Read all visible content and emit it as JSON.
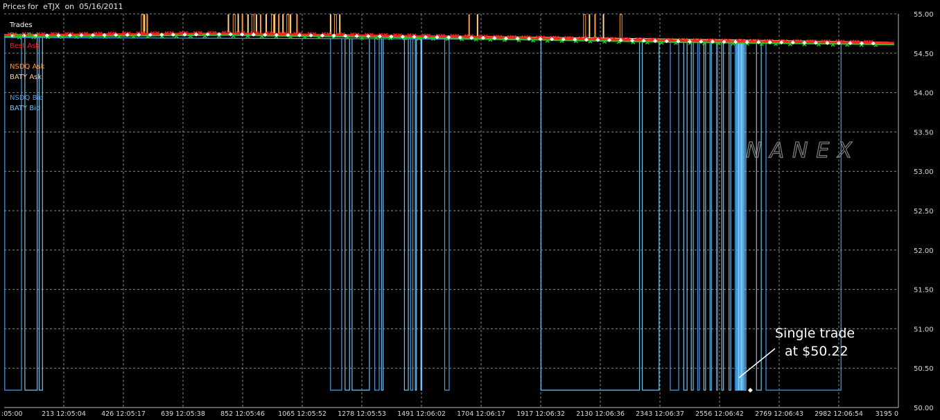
{
  "header": {
    "title": "Prices for  eTJX  on  05/16/2011"
  },
  "watermark": "NANEX",
  "colors": {
    "background": "#000000",
    "grid": "#8a8a8a",
    "trades": "#ffffff",
    "best_bid": "#22cc22",
    "best_ask": "#ff2020",
    "nsdq_ask": "#ff9a3c",
    "baty_ask": "#ffd28a",
    "nsdq_bid": "#4a9ee8",
    "baty_bid": "#6fc4f2"
  },
  "chart_data": {
    "type": "line",
    "title": "Prices for  eTJX  on  05/16/2011",
    "xlabel": "",
    "ylabel": "",
    "xlim": [
      0,
      3195
    ],
    "ylim": [
      50.0,
      55.0
    ],
    "grid": true,
    "legend_placement": "top-left",
    "y_ticks": [
      "50.00",
      "50.50",
      "51.00",
      "51.50",
      "52.00",
      "52.50",
      "53.00",
      "53.50",
      "54.00",
      "54.50",
      "55.00"
    ],
    "x_ticks": [
      {
        "x": 0,
        "label": ":05:00"
      },
      {
        "x": 213,
        "label": "213 12:05:04"
      },
      {
        "x": 426,
        "label": "426 12:05:17"
      },
      {
        "x": 639,
        "label": "639 12:05:38"
      },
      {
        "x": 852,
        "label": "852 12:05:46"
      },
      {
        "x": 1065,
        "label": "1065 12:05:52"
      },
      {
        "x": 1278,
        "label": "1278 12:05:53"
      },
      {
        "x": 1491,
        "label": "1491 12:06:02"
      },
      {
        "x": 1704,
        "label": "1704 12:06:17"
      },
      {
        "x": 1917,
        "label": "1917 12:06:32"
      },
      {
        "x": 2130,
        "label": "2130 12:06:36"
      },
      {
        "x": 2343,
        "label": "2343 12:06:37"
      },
      {
        "x": 2556,
        "label": "2556 12:06:42"
      },
      {
        "x": 2769,
        "label": "2769 12:06:43"
      },
      {
        "x": 2982,
        "label": "2982 12:06:54"
      },
      {
        "x": 3195,
        "label": "3195 0"
      }
    ],
    "legend": [
      {
        "key": "trades",
        "label": "Trades"
      },
      {
        "key": "best_bid",
        "label": "Best Bid"
      },
      {
        "key": "best_ask",
        "label": "Best Ask"
      },
      {
        "key": "nsdq_ask",
        "label": "NSDQ Ask"
      },
      {
        "key": "baty_ask",
        "label": "BATY Ask"
      },
      {
        "key": "nsdq_bid",
        "label": "NSDQ Bid"
      },
      {
        "key": "baty_bid",
        "label": "BATY Bid"
      }
    ],
    "series": [
      {
        "name": "Best Ask",
        "x": [
          0,
          800,
          1600,
          2400,
          3195
        ],
        "values": [
          54.73,
          54.75,
          54.71,
          54.66,
          54.63
        ]
      },
      {
        "name": "Best Bid",
        "x": [
          0,
          800,
          1600,
          2400,
          3195
        ],
        "values": [
          54.71,
          54.73,
          54.69,
          54.64,
          54.61
        ]
      },
      {
        "name": "BATY Ask",
        "x": [
          0,
          1600,
          3195
        ],
        "values": [
          54.74,
          54.72,
          54.64
        ]
      },
      {
        "name": "NSDQ Bid",
        "x": [
          0,
          1600,
          3195
        ],
        "values": [
          54.7,
          54.68,
          54.61
        ]
      }
    ],
    "ask_spikes_x": [
      490,
      500,
      510,
      800,
      818,
      835,
      850,
      870,
      885,
      900,
      915,
      935,
      955,
      965,
      980,
      995,
      1010,
      1022,
      1045,
      1165,
      1180,
      1198,
      1660,
      1690,
      2070,
      2090,
      2110,
      2140,
      2200
    ],
    "bid_drops": [
      {
        "x0": 2,
        "x1": 62
      },
      {
        "x0": 74,
        "x1": 118
      },
      {
        "x0": 125,
        "x1": 137
      },
      {
        "x0": 1166,
        "x1": 1206
      },
      {
        "x0": 1218,
        "x1": 1234
      },
      {
        "x0": 1243,
        "x1": 1305
      },
      {
        "x0": 1324,
        "x1": 1340
      },
      {
        "x0": 1348,
        "x1": 1354
      },
      {
        "x0": 1430,
        "x1": 1444
      },
      {
        "x0": 1452,
        "x1": 1460
      },
      {
        "x0": 1469,
        "x1": 1473
      },
      {
        "x0": 1489,
        "x1": 1492
      },
      {
        "x0": 1574,
        "x1": 1590
      },
      {
        "x0": 1918,
        "x1": 2270
      },
      {
        "x0": 2280,
        "x1": 2340
      },
      {
        "x0": 2380,
        "x1": 2410
      },
      {
        "x0": 2428,
        "x1": 2440
      },
      {
        "x0": 2455,
        "x1": 2462
      },
      {
        "x0": 2478,
        "x1": 2484
      },
      {
        "x0": 2500,
        "x1": 2506
      },
      {
        "x0": 2522,
        "x1": 2527
      },
      {
        "x0": 2545,
        "x1": 2549
      },
      {
        "x0": 2564,
        "x1": 2570
      },
      {
        "x0": 2590,
        "x1": 2596
      },
      {
        "x0": 2612,
        "x1": 2616
      },
      {
        "x0": 2618,
        "x1": 2622
      },
      {
        "x0": 2624,
        "x1": 2626
      },
      {
        "x0": 2628,
        "x1": 2630
      },
      {
        "x0": 2632,
        "x1": 2634
      },
      {
        "x0": 2636,
        "x1": 2638
      },
      {
        "x0": 2640,
        "x1": 2642
      },
      {
        "x0": 2645,
        "x1": 2650
      },
      {
        "x0": 2688,
        "x1": 2705
      },
      {
        "x0": 2722,
        "x1": 2990
      }
    ],
    "low_price": 50.22,
    "single_trade": {
      "x": 2666,
      "y": 50.22
    },
    "annotation": {
      "line1": "Single trade",
      "line2": "at $50.22"
    }
  }
}
